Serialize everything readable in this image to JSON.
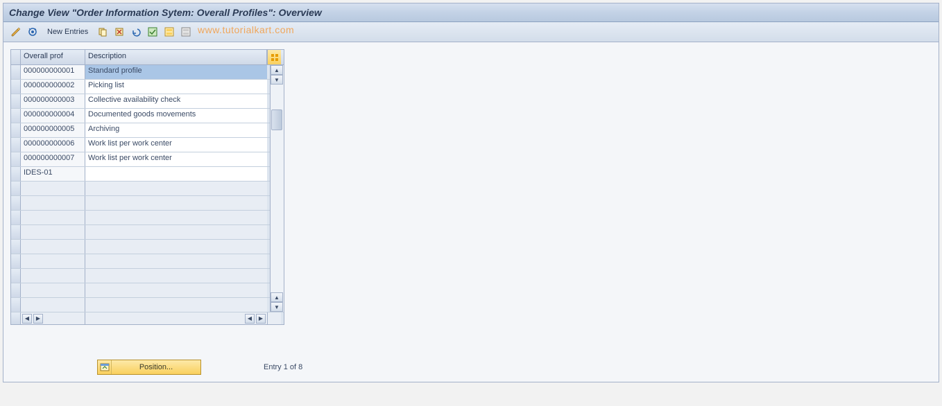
{
  "title": "Change View \"Order Information Sytem: Overall Profiles\": Overview",
  "toolbar": {
    "new_entries": "New Entries"
  },
  "watermark": "www.tutorialkart.com",
  "columns": {
    "prof": "Overall prof",
    "desc": "Description"
  },
  "rows": [
    {
      "prof": "000000000001",
      "desc": "Standard profile",
      "selected": true
    },
    {
      "prof": "000000000002",
      "desc": "Picking list",
      "selected": false
    },
    {
      "prof": "000000000003",
      "desc": "Collective availability check",
      "selected": false
    },
    {
      "prof": "000000000004",
      "desc": "Documented goods movements",
      "selected": false
    },
    {
      "prof": "000000000005",
      "desc": "Archiving",
      "selected": false
    },
    {
      "prof": "000000000006",
      "desc": "Work list per work center",
      "selected": false
    },
    {
      "prof": "000000000007",
      "desc": "Work list per work center",
      "selected": false
    },
    {
      "prof": "IDES-01",
      "desc": "",
      "selected": false
    }
  ],
  "empty_row_count": 9,
  "position_btn": "Position...",
  "entry_status": "Entry 1 of 8"
}
